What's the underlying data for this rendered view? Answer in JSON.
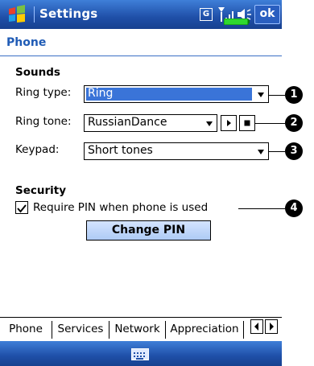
{
  "title_bar": {
    "title": "Settings",
    "ok_label": "ok",
    "network_letter": "G"
  },
  "page": {
    "heading": "Phone"
  },
  "sounds": {
    "section_label": "Sounds",
    "ring_type": {
      "label": "Ring type:",
      "value": "Ring"
    },
    "ring_tone": {
      "label": "Ring tone:",
      "value": "RussianDance"
    },
    "keypad": {
      "label": "Keypad:",
      "value": "Short tones"
    }
  },
  "security": {
    "section_label": "Security",
    "require_pin_label": "Require PIN when phone is used",
    "require_pin_checked": true,
    "change_pin_label": "Change PIN"
  },
  "callouts": [
    "1",
    "2",
    "3",
    "4"
  ],
  "tabs": [
    "Phone",
    "Services",
    "Network",
    "Appreciation"
  ],
  "colors": {
    "title_bar": "#1f4fa8",
    "selection": "#3a74d8",
    "heading": "#1f5bb5",
    "button": "#aecbf5"
  },
  "icons": [
    "windows-start-icon",
    "signal-icon",
    "speaker-icon",
    "battery-icon",
    "play-icon",
    "stop-icon",
    "check-icon",
    "keyboard-icon",
    "scroll-left-icon",
    "scroll-right-icon"
  ]
}
